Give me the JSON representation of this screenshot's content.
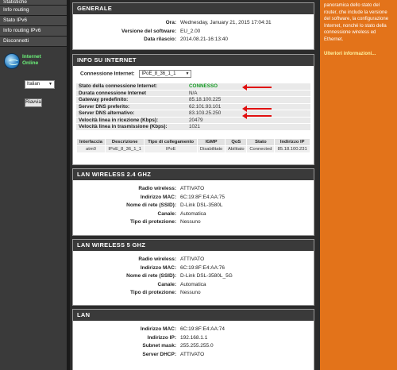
{
  "sidebar": {
    "items": [
      {
        "label": "Statistiche"
      },
      {
        "label": "Info routing"
      },
      {
        "label": "Stato IPv6"
      },
      {
        "label": "Info routing IPv6"
      },
      {
        "label": "Disconnetti"
      }
    ],
    "status": "Internet Online",
    "language": "Italian",
    "apply_label": "Riavvia"
  },
  "help": {
    "text": "panoramica dello stato del router, che include la versione del software, la configurazione Internet, nonché lo stato della connessione wireless ed Ethernet.",
    "more": "Ulteriori informazioni..."
  },
  "generale": {
    "title": "GENERALE",
    "rows": [
      {
        "label": "Ora:",
        "value": "Wednesday, January 21, 2015 17:04:31"
      },
      {
        "label": "Versione del software:",
        "value": "EU_2.00"
      },
      {
        "label": "Data rilascio:",
        "value": "2014.08.21-16:13:40"
      }
    ]
  },
  "internet": {
    "title": "INFO SU INTERNET",
    "conn_label": "Connessione Internet:",
    "conn_value": "IPoE_8_36_1_1",
    "rows": [
      {
        "label": "Stato della connessione Internet:",
        "value": "CONNESSO"
      },
      {
        "label": "Durata connessione Internet",
        "value": "N/A"
      },
      {
        "label": "Gateway predefinito:",
        "value": "85.18.100.225"
      },
      {
        "label": "Server DNS preferito:",
        "value": "62.101.93.101"
      },
      {
        "label": "Server DNS alternativo:",
        "value": "83.103.25.250"
      },
      {
        "label": "Velocità linea in ricezione (Kbps):",
        "value": "20479"
      },
      {
        "label": "Velocità linea in trasmissione (Kbps):",
        "value": "1021"
      }
    ],
    "table": {
      "headers": [
        "Interfaccia",
        "Descrizione",
        "Tipo di collegamento",
        "IGMP",
        "QoS",
        "Stato",
        "Indirizzo IP"
      ],
      "rows": [
        [
          "atm0",
          "IPoE_8_36_1_1",
          "IPoE",
          "Disabilitato",
          "Abilitato",
          "Connected",
          "85.18.100.231"
        ]
      ]
    },
    "colors": {
      "connected": "#159a24",
      "arrow": "#e01010"
    }
  },
  "wlan24": {
    "title": "LAN WIRELESS 2.4 GHZ",
    "rows": [
      {
        "label": "Radio wireless:",
        "value": "ATTIVATO"
      },
      {
        "label": "Indirizzo MAC:",
        "value": "6C:19:8F:E4:AA:75"
      },
      {
        "label": "Nome di rete (SSID):",
        "value": "D-Link DSL-3580L"
      },
      {
        "label": "Canale:",
        "value": "Automatica"
      },
      {
        "label": "Tipo di protezione:",
        "value": "Nessuno"
      }
    ]
  },
  "wlan5": {
    "title": "LAN WIRELESS 5 GHZ",
    "rows": [
      {
        "label": "Radio wireless:",
        "value": "ATTIVATO"
      },
      {
        "label": "Indirizzo MAC:",
        "value": "6C:19:8F:E4:AA:76"
      },
      {
        "label": "Nome di rete (SSID):",
        "value": "D-Link DSL-3580L_5G"
      },
      {
        "label": "Canale:",
        "value": "Automatica"
      },
      {
        "label": "Tipo di protezione:",
        "value": "Nessuno"
      }
    ]
  },
  "lan": {
    "title": "LAN",
    "rows": [
      {
        "label": "Indirizzo MAC:",
        "value": "6C:19:8F:E4:AA:74"
      },
      {
        "label": "Indirizzo IP:",
        "value": "192.168.1.1"
      },
      {
        "label": "Subnet mask:",
        "value": "255.255.255.0"
      },
      {
        "label": "Server DHCP:",
        "value": "ATTIVATO"
      }
    ]
  }
}
